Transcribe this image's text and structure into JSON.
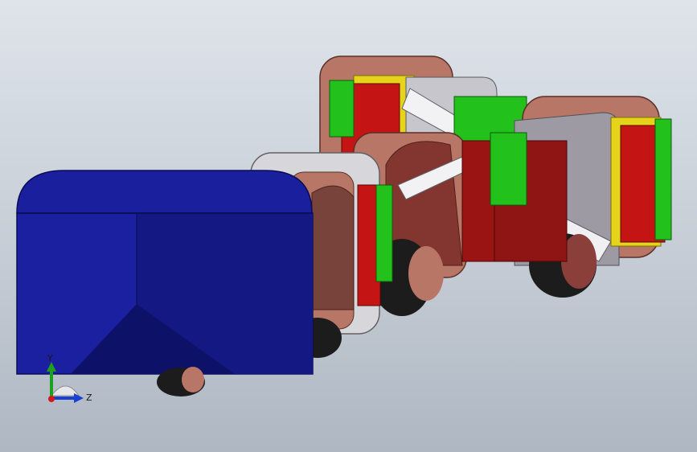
{
  "viewport": {
    "background_top": "#dfe4ea",
    "background_bottom": "#aeb7c2"
  },
  "model": {
    "description_icon": "robot-snake-assembly-3d-model",
    "colors": {
      "head_blue": "#1a1f9e",
      "head_blue_dark": "#11157a",
      "module_brown": "#b87766",
      "module_gray": "#9d9aa4",
      "red_servo": "#c41414",
      "green_board": "#22c11b",
      "yellow_frame": "#e6d41a",
      "wheel_dark": "#1c1c1c"
    }
  },
  "triad": {
    "y_label": "Y",
    "z_label": "Z",
    "y_color": "#1fa01f",
    "z_color": "#1a3fd1",
    "x_color": "#d11a1a"
  }
}
